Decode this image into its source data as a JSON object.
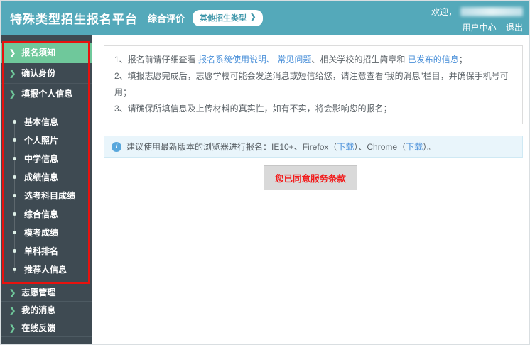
{
  "colors": {
    "header_teal": "#54a9ba",
    "sidebar_dark": "#3e4a52",
    "active_green": "#6fc89b",
    "annotation_red": "#e8120e",
    "link_blue": "#4a90d9",
    "button_text_red": "#f21a1a"
  },
  "header": {
    "title": "特殊类型招生报名平台",
    "subtitle": "综合评价",
    "other_types_button": "其他招生类型",
    "chevron_icon": "❯",
    "welcome_prefix": "欢迎，",
    "user_center": "用户中心",
    "logout": "退出"
  },
  "sidebar": {
    "arrow_icon": "❯",
    "top_items": [
      {
        "label": "报名须知",
        "active": true
      },
      {
        "label": "确认身份",
        "active": false
      },
      {
        "label": "填报个人信息",
        "active": false
      }
    ],
    "sub_items": [
      {
        "label": "基本信息"
      },
      {
        "label": "个人照片"
      },
      {
        "label": "中学信息"
      },
      {
        "label": "成绩信息"
      },
      {
        "label": "选考科目成绩"
      },
      {
        "label": "综合信息"
      },
      {
        "label": "模考成绩"
      },
      {
        "label": "单科排名"
      },
      {
        "label": "推荐人信息"
      }
    ],
    "bottom_items": [
      {
        "label": "志愿管理"
      },
      {
        "label": "我的消息"
      },
      {
        "label": "在线反馈"
      }
    ]
  },
  "notice": {
    "line1_prefix": "1、报名前请仔细查看 ",
    "line1_link_usage": "报名系统使用说明、",
    "line1_sep1": " ",
    "line1_link_faq": "常见问题",
    "line1_mid": "、相关学校的招生简章和 ",
    "line1_link_published": "已发布的信息",
    "line1_end": "；",
    "line2": "2、填报志愿完成后，志愿学校可能会发送消息或短信给您，请注意查看“我的消息”栏目，并确保手机号可用；",
    "line3": "3、请确保所填信息及上传材料的真实性，如有不实，将会影响您的报名；"
  },
  "tip": {
    "icon_glyph": "i",
    "text_prefix": "建议使用最新版本的浏览器进行报名：IE10+、Firefox（",
    "download_label_1": "下载",
    "text_mid": "）、Chrome（",
    "download_label_2": "下载",
    "text_end": "）。"
  },
  "main": {
    "agree_button_label": "您已同意服务条款"
  }
}
